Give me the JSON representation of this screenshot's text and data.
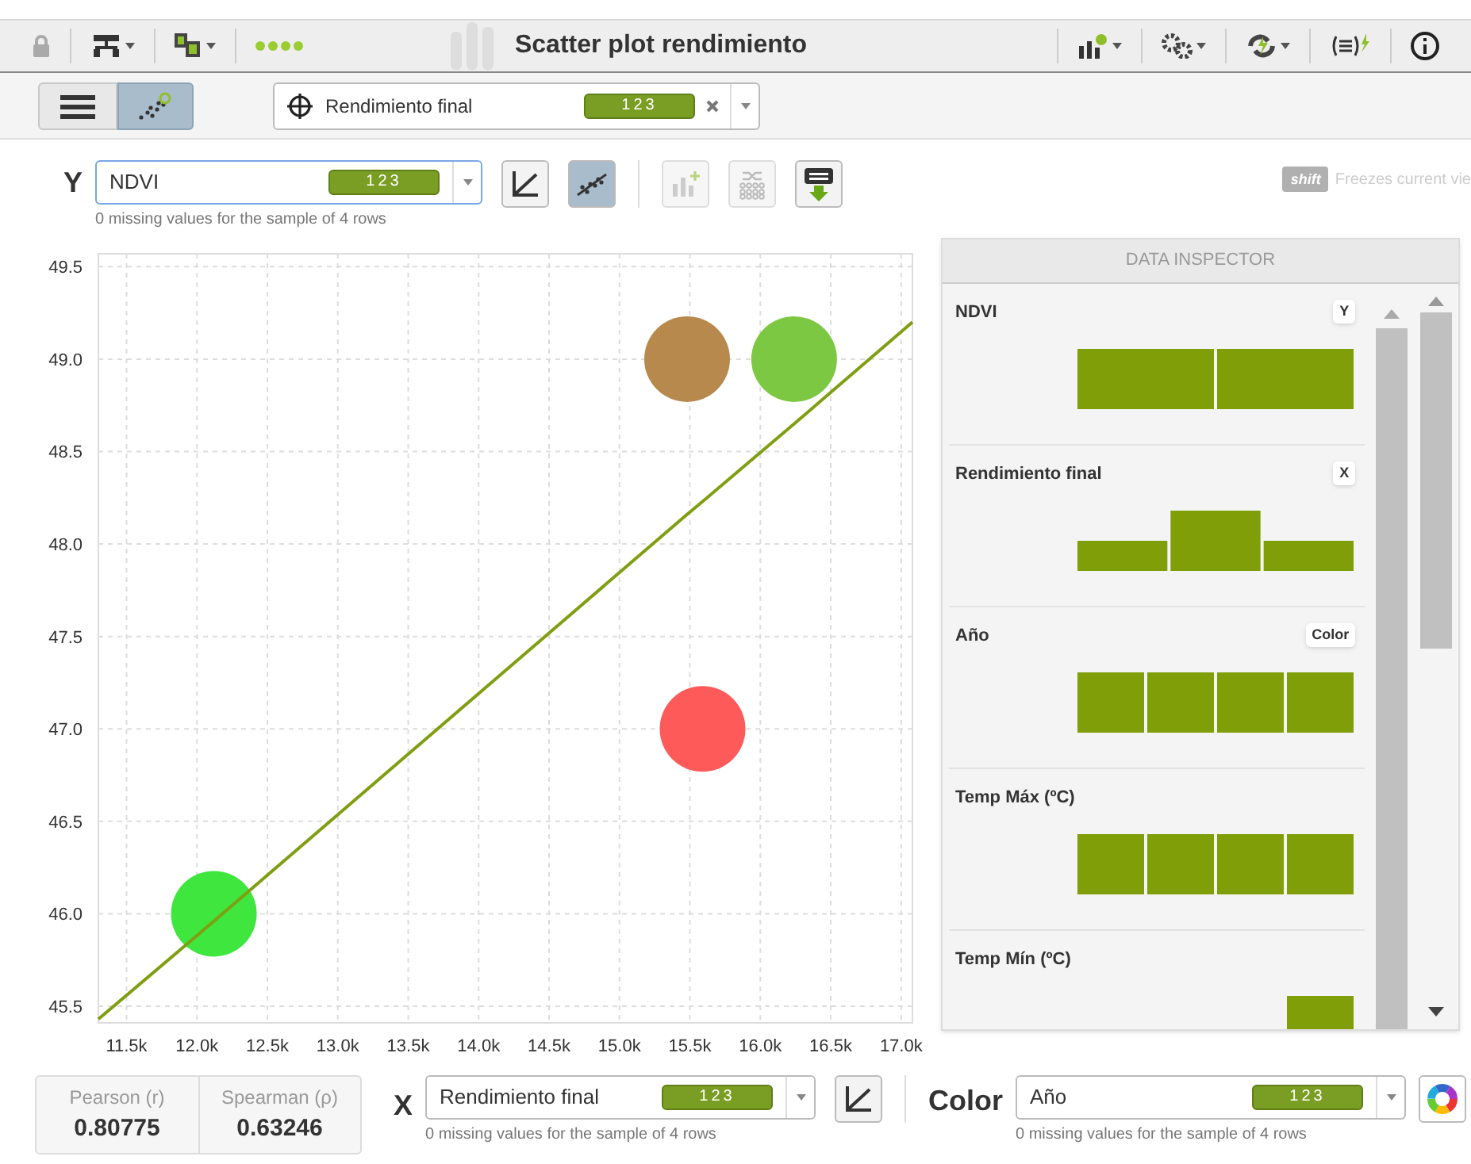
{
  "toolbar": {
    "title": "Scatter plot rendimiento"
  },
  "objective": {
    "value": "Rendimiento final",
    "badge": "123"
  },
  "y_axis": {
    "label": "Y",
    "value": "NDVI",
    "badge": "123",
    "note": "0 missing values for the sample of 4 rows"
  },
  "shift_hint": {
    "key": "shift",
    "text": "Freezes current vie"
  },
  "chart_data": {
    "type": "scatter",
    "xlim": [
      11300,
      17080
    ],
    "ylim": [
      45.41,
      49.57
    ],
    "xticks": [
      {
        "value": 11500,
        "label": "11.5k"
      },
      {
        "value": 12000,
        "label": "12.0k"
      },
      {
        "value": 12500,
        "label": "12.5k"
      },
      {
        "value": 13000,
        "label": "13.0k"
      },
      {
        "value": 13500,
        "label": "13.5k"
      },
      {
        "value": 14000,
        "label": "14.0k"
      },
      {
        "value": 14500,
        "label": "14.5k"
      },
      {
        "value": 15000,
        "label": "15.0k"
      },
      {
        "value": 15500,
        "label": "15.5k"
      },
      {
        "value": 16000,
        "label": "16.0k"
      },
      {
        "value": 16500,
        "label": "16.5k"
      },
      {
        "value": 17000,
        "label": "17.0k"
      }
    ],
    "yticks": [
      {
        "value": 45.5,
        "label": "45.5"
      },
      {
        "value": 46,
        "label": "46.0"
      },
      {
        "value": 46.5,
        "label": "46.5"
      },
      {
        "value": 47,
        "label": "47.0"
      },
      {
        "value": 47.5,
        "label": "47.5"
      },
      {
        "value": 48,
        "label": "48.0"
      },
      {
        "value": 48.5,
        "label": "48.5"
      },
      {
        "value": 49,
        "label": "49.0"
      },
      {
        "value": 49.5,
        "label": "49.5"
      }
    ],
    "grid": true,
    "x": [
      11300,
      15480,
      16240,
      15590,
      12120,
      17080
    ],
    "series": [
      {
        "color": "#b8894d",
        "values": [
          null,
          49.0,
          null,
          null,
          null,
          null
        ]
      },
      {
        "color": "#7dc843",
        "values": [
          null,
          null,
          49.0,
          null,
          null,
          null
        ]
      },
      {
        "color": "#ff5a5a",
        "values": [
          null,
          null,
          null,
          47.0,
          null,
          null
        ]
      },
      {
        "color": "#3ee63e",
        "values": [
          null,
          null,
          null,
          null,
          46.0,
          null
        ]
      },
      {
        "type": "line",
        "color": "#7f9f12",
        "values": [
          45.43,
          48.16,
          48.65,
          48.23,
          45.96,
          49.2
        ]
      }
    ]
  },
  "inspector": {
    "title": "DATA INSPECTOR",
    "fields": [
      {
        "name": "NDVI",
        "role": "Y"
      },
      {
        "name": "Rendimiento final",
        "role": "X"
      },
      {
        "name": "Año",
        "role": "Color"
      },
      {
        "name": "Temp Máx (ºC)"
      },
      {
        "name": "Temp Mín (ºC)"
      }
    ]
  },
  "correlation": [
    {
      "label": "Pearson (r)",
      "value": "0.80775"
    },
    {
      "label": "Spearman (ρ)",
      "value": "0.63246"
    }
  ],
  "x_axis": {
    "label": "X",
    "value": "Rendimiento final",
    "badge": "123",
    "note": "0 missing values for the sample of 4 rows"
  },
  "color_axis": {
    "label": "Color",
    "value": "Año",
    "badge": "123",
    "note": "0 missing values for the sample of 4 rows"
  }
}
